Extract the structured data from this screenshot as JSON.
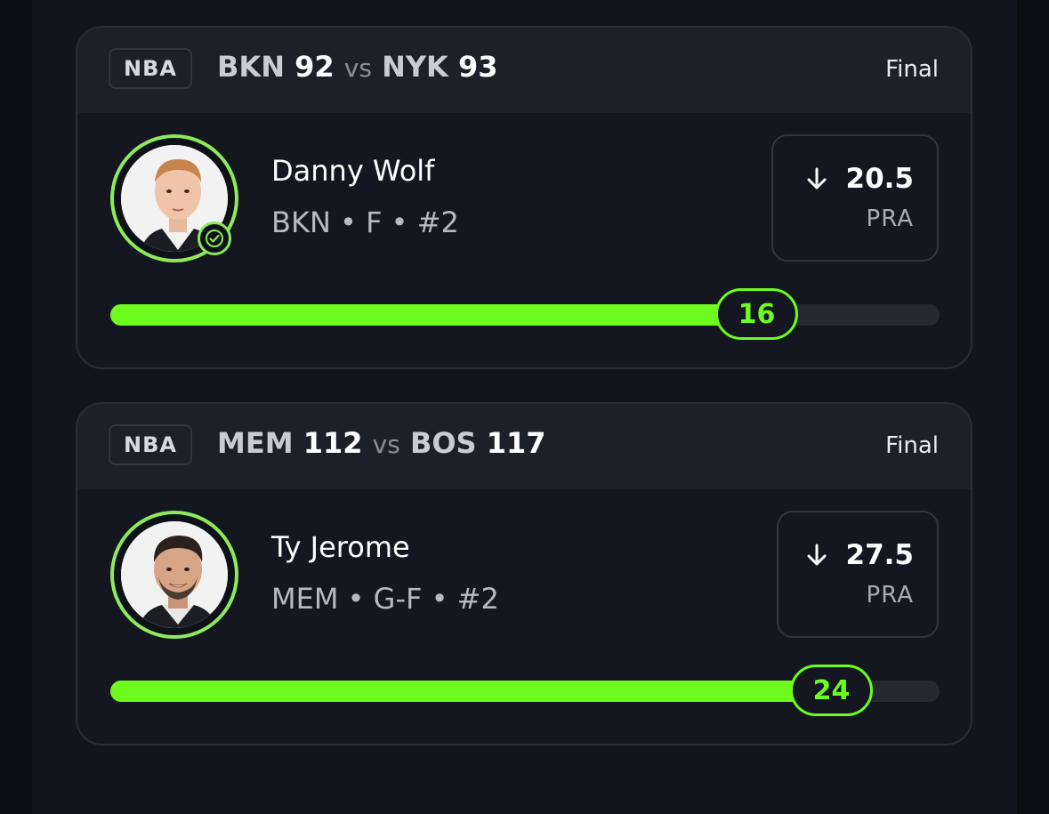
{
  "cards": [
    {
      "league": "NBA",
      "home_team": "BKN",
      "home_score": "92",
      "vs": "vs",
      "away_team": "NYK",
      "away_score": "93",
      "status": "Final",
      "player_name": "Danny Wolf",
      "player_meta": "BKN • F • #2",
      "direction_icon": "arrow-down-icon",
      "line": "20.5",
      "stat": "PRA",
      "actual": "16",
      "progress_fraction": 0.78,
      "verified": true
    },
    {
      "league": "NBA",
      "home_team": "MEM",
      "home_score": "112",
      "vs": "vs",
      "away_team": "BOS",
      "away_score": "117",
      "status": "Final",
      "player_name": "Ty Jerome",
      "player_meta": "MEM • G-F • #2",
      "direction_icon": "arrow-down-icon",
      "line": "27.5",
      "stat": "PRA",
      "actual": "24",
      "progress_fraction": 0.87,
      "verified": false
    }
  ],
  "colors": {
    "accent": "#6dfc1e",
    "ring": "#8eea5a",
    "card_bg": "#14171f",
    "header_bg": "#1d2029"
  }
}
